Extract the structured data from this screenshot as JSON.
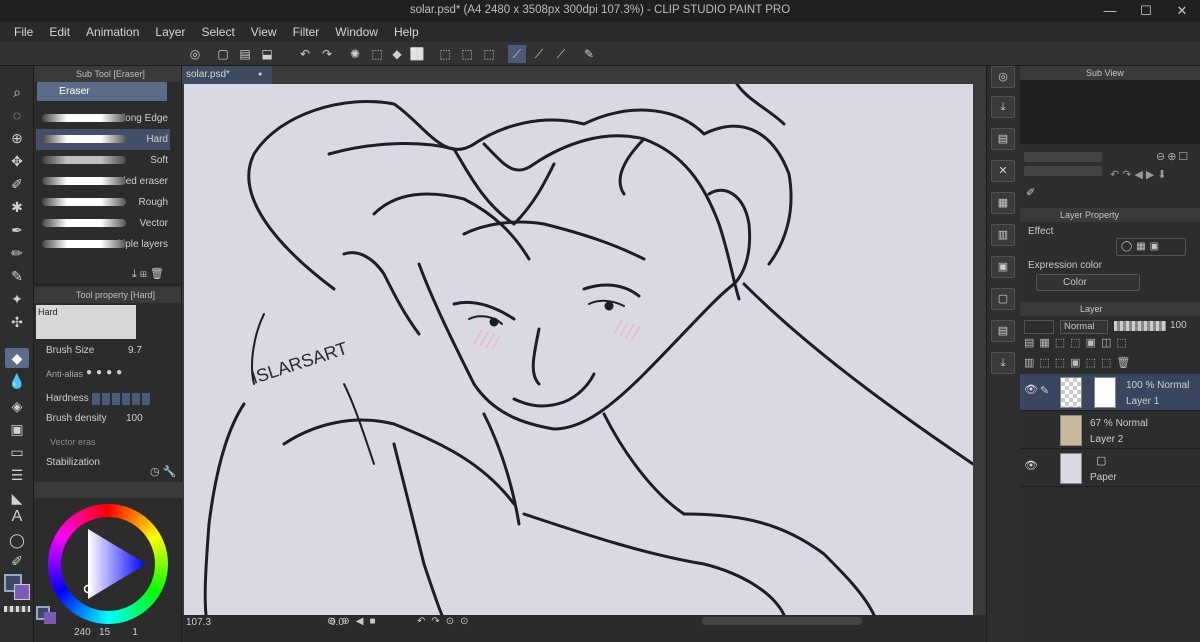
{
  "window": {
    "title": "solar.psd* (A4 2480 x 3508px 300dpi 107.3%) - CLIP STUDIO PAINT PRO",
    "minimize": "—",
    "maximize": "☐",
    "close": "✕"
  },
  "menu": [
    "File",
    "Edit",
    "Animation",
    "Layer",
    "Select",
    "View",
    "Filter",
    "Window",
    "Help"
  ],
  "doc_tab": {
    "label": "solar.psd*",
    "dot": "●"
  },
  "subtool": {
    "header": "Sub Tool [Eraser]",
    "group": "Eraser",
    "items": [
      {
        "label": "Erase Along Edge",
        "selected": false
      },
      {
        "label": "Hard",
        "selected": true
      },
      {
        "label": "Soft",
        "selected": false
      },
      {
        "label": "Kneaded eraser",
        "selected": false
      },
      {
        "label": "Rough",
        "selected": false
      },
      {
        "label": "Vector",
        "selected": false
      },
      {
        "label": "Multiple layers",
        "selected": false
      }
    ]
  },
  "toolprop": {
    "header": "Tool property [Hard]",
    "preview_label": "Hard",
    "brush_size_label": "Brush Size",
    "brush_size_value": "9.7",
    "antialias_label": "Anti-alias",
    "hardness_label": "Hardness",
    "brush_density_label": "Brush density",
    "brush_density_value": "100",
    "vector_label": "Vector eras",
    "stabilization_label": "Stabilization"
  },
  "color": {
    "main_color": "#3b4a6b",
    "sub_color": "#7b5bb5",
    "readout_a": "240",
    "readout_b": "15",
    "readout_c": "1"
  },
  "canvas": {
    "bg_color": "#d9d9e3",
    "signature": "ISLARSART"
  },
  "status": {
    "zoom": "107.3",
    "angle": "0.0"
  },
  "subview": {
    "header": "Sub View"
  },
  "layer_property": {
    "header": "Layer Property",
    "effect_label": "Effect",
    "expression_label": "Expression color",
    "expression_value": "Color"
  },
  "layers": {
    "header": "Layer",
    "blend_mode": "Normal",
    "opacity": "100",
    "items": [
      {
        "opacity_mode": "100 % Normal",
        "name": "Layer 1",
        "visible": true,
        "selected": true
      },
      {
        "opacity_mode": "67 % Normal",
        "name": "Layer 2",
        "visible": false,
        "selected": false
      },
      {
        "opacity_mode": "",
        "name": "Paper",
        "visible": true,
        "selected": false
      }
    ]
  },
  "icons": {
    "tools": [
      "zoom-icon",
      "lasso-icon",
      "select-icon",
      "move-icon",
      "eyedropper-icon",
      "magic-icon",
      "pen-icon",
      "pencil-icon",
      "brush-icon",
      "airbrush-icon",
      "eraser-icon",
      "blend-icon",
      "fill-icon",
      "gradient-icon",
      "shape-icon",
      "frame-icon",
      "ruler-icon",
      "text-icon",
      "balloon-icon",
      "correct-line-icon"
    ]
  }
}
